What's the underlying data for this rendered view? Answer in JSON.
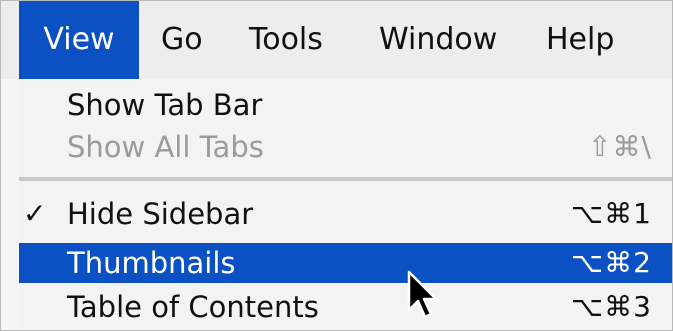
{
  "menubar": {
    "items": [
      {
        "label": "View"
      },
      {
        "label": "Go"
      },
      {
        "label": "Tools"
      },
      {
        "label": "Window"
      },
      {
        "label": "Help"
      }
    ],
    "active": "View"
  },
  "menu": {
    "items": [
      {
        "label": "Show Tab Bar",
        "shortcut": "",
        "checked": false,
        "enabled": true
      },
      {
        "label": "Show All Tabs",
        "shortcut": "⇧⌘\\",
        "checked": false,
        "enabled": false
      },
      {
        "label": "Hide Sidebar",
        "shortcut": "⌥⌘1",
        "checked": true,
        "check_glyph": "✓",
        "enabled": true
      },
      {
        "label": "Thumbnails",
        "shortcut": "⌥⌘2",
        "checked": false,
        "enabled": true,
        "highlighted": true
      },
      {
        "label": "Table of Contents",
        "shortcut": "⌥⌘3",
        "checked": false,
        "enabled": true
      }
    ]
  },
  "colors": {
    "highlight": "#0c51c3",
    "disabled_text": "#9b9b9b",
    "menu_background": "#f3f3f3"
  },
  "icons": {
    "cursor": "arrow-pointer-icon",
    "check": "checkmark-icon"
  }
}
